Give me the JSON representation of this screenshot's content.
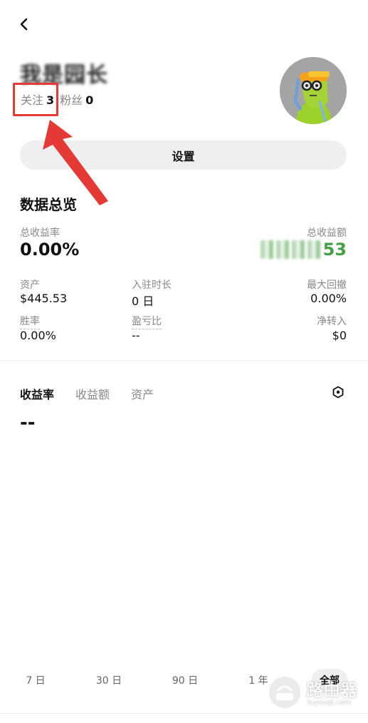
{
  "profile": {
    "username": "我是园长",
    "following_label": "关注",
    "following_count": "3",
    "followers_label": "粉丝",
    "followers_count": "0"
  },
  "settings_label": "设置",
  "overview": {
    "title": "数据总览",
    "total_return_rate_label": "总收益率",
    "total_return_rate_value": "0.00%",
    "total_profit_label": "总收益额",
    "total_profit_visible_suffix": "53",
    "assets_label": "资产",
    "assets_value": "$445.53",
    "joined_label": "入驻时长",
    "joined_value": "0 日",
    "max_drawdown_label": "最大回撤",
    "max_drawdown_value": "0.00%",
    "win_rate_label": "胜率",
    "win_rate_value": "0.00%",
    "pnl_ratio_label": "盈亏比",
    "pnl_ratio_value": "--",
    "net_transfer_label": "净转入",
    "net_transfer_value": "$0"
  },
  "chart": {
    "tabs": [
      "收益率",
      "收益额",
      "资产"
    ],
    "active_tab": 0,
    "current_value": "--",
    "ranges": [
      "7 日",
      "30 日",
      "90 日",
      "1 年",
      "全部"
    ],
    "active_range": 4
  },
  "watermark": {
    "brand": "路由器",
    "site": "luyouqi.com"
  },
  "colors": {
    "accent_red": "#e53935",
    "profit_green": "#43a047"
  }
}
